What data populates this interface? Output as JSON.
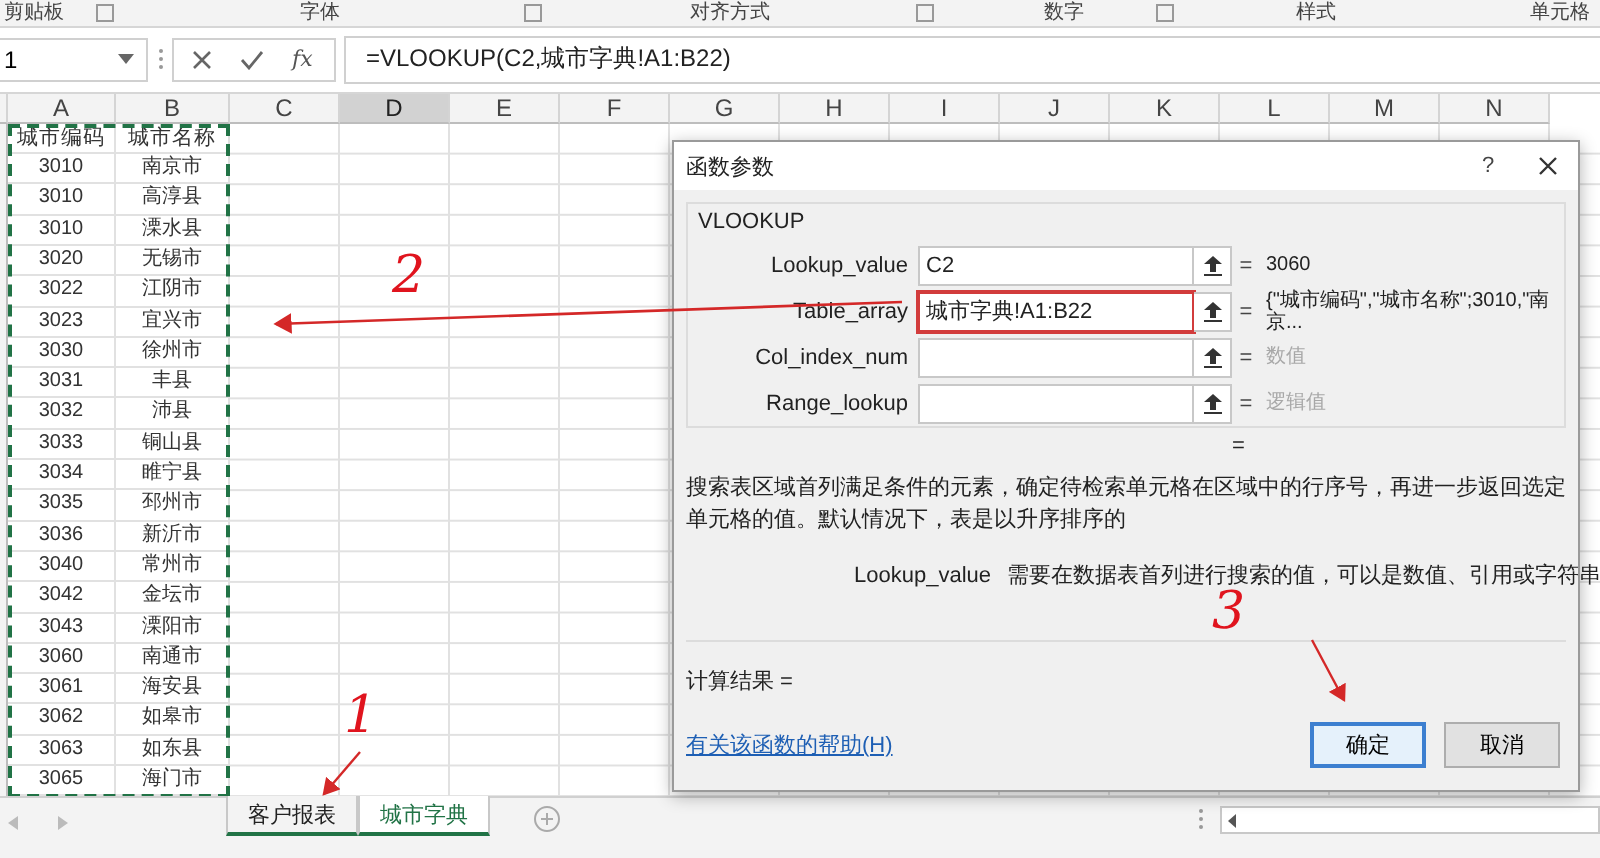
{
  "ribbon_groups": [
    "剪贴板",
    "字体",
    "对齐方式",
    "数字",
    "样式",
    "单元格"
  ],
  "name_box": "1",
  "formula_bar": {
    "fx": "fx",
    "formula": "=VLOOKUP(C2,城市字典!A1:B22)"
  },
  "columns": [
    {
      "label": "A",
      "selected": false
    },
    {
      "label": "B",
      "selected": false
    },
    {
      "label": "C",
      "selected": false
    },
    {
      "label": "D",
      "selected": true
    },
    {
      "label": "E",
      "selected": false
    },
    {
      "label": "F",
      "selected": false
    },
    {
      "label": "G",
      "selected": false
    },
    {
      "label": "H",
      "selected": false
    },
    {
      "label": "I",
      "selected": false
    },
    {
      "label": "J",
      "selected": false
    },
    {
      "label": "K",
      "selected": false
    },
    {
      "label": "L",
      "selected": false
    },
    {
      "label": "M",
      "selected": false
    },
    {
      "label": "N",
      "selected": false
    }
  ],
  "rows": [
    [
      "城市编码",
      "城市名称"
    ],
    [
      "3010",
      "南京市"
    ],
    [
      "3010",
      "高淳县"
    ],
    [
      "3010",
      "溧水县"
    ],
    [
      "3020",
      "无锡市"
    ],
    [
      "3022",
      "江阴市"
    ],
    [
      "3023",
      "宜兴市"
    ],
    [
      "3030",
      "徐州市"
    ],
    [
      "3031",
      "丰县"
    ],
    [
      "3032",
      "沛县"
    ],
    [
      "3033",
      "铜山县"
    ],
    [
      "3034",
      "睢宁县"
    ],
    [
      "3035",
      "邳州市"
    ],
    [
      "3036",
      "新沂市"
    ],
    [
      "3040",
      "常州市"
    ],
    [
      "3042",
      "金坛市"
    ],
    [
      "3043",
      "溧阳市"
    ],
    [
      "3060",
      "南通市"
    ],
    [
      "3061",
      "海安县"
    ],
    [
      "3062",
      "如皋市"
    ],
    [
      "3063",
      "如东县"
    ],
    [
      "3065",
      "海门市"
    ]
  ],
  "dialog": {
    "title": "函数参数",
    "help": "?",
    "function_name": "VLOOKUP",
    "arguments": [
      {
        "label": "Lookup_value",
        "value": "C2",
        "equals": "=",
        "result": "3060",
        "kind": "value",
        "highlighted": false
      },
      {
        "label": "Table_array",
        "value": "城市字典!A1:B22",
        "equals": "=",
        "result": "{\"城市编码\",\"城市名称\";3010,\"南京...",
        "kind": "value",
        "highlighted": true
      },
      {
        "label": "Col_index_num",
        "equals": "=",
        "result": "数值",
        "kind": "hint",
        "highlighted": false
      },
      {
        "label": "Range_lookup",
        "equals": "=",
        "result": "逻辑值",
        "kind": "hint",
        "highlighted": false
      }
    ],
    "formula_equals": "=",
    "description": "搜索表区域首列满足条件的元素，确定待检索单元格在区域中的行序号，再进一步返回选定单元格的值。默认情况下，表是以升序排序的",
    "arg_help": {
      "name": "Lookup_value",
      "text": "需要在数据表首列进行搜索的值，可以是数值、引用或字符串"
    },
    "result_label": "计算结果 =",
    "help_link": "有关该函数的帮助(H)",
    "buttons": [
      {
        "label": "确定",
        "default": true
      },
      {
        "label": "取消",
        "default": false
      }
    ]
  },
  "sheet_tabs": [
    {
      "label": "客户报表",
      "selected": false
    },
    {
      "label": "城市字典",
      "selected": true
    }
  ],
  "annotations": [
    {
      "label": "2"
    },
    {
      "label": "3"
    },
    {
      "label": "1"
    }
  ]
}
